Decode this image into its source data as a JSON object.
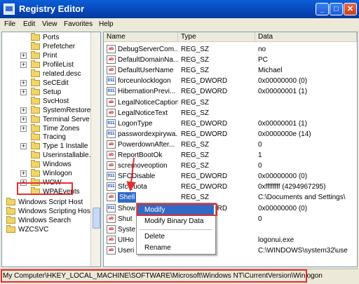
{
  "window": {
    "title": "Registry Editor",
    "min_label": "_",
    "max_label": "□",
    "close_label": "✕"
  },
  "menu": {
    "items": [
      "File",
      "Edit",
      "View",
      "Favorites",
      "Help"
    ]
  },
  "tree": {
    "items": [
      {
        "label": "Ports",
        "expandable": false
      },
      {
        "label": "Prefetcher",
        "expandable": false
      },
      {
        "label": "Print",
        "expandable": true
      },
      {
        "label": "ProfileList",
        "expandable": true
      },
      {
        "label": "related.desc",
        "expandable": false
      },
      {
        "label": "SeCEdit",
        "expandable": true
      },
      {
        "label": "Setup",
        "expandable": true
      },
      {
        "label": "SvcHost",
        "expandable": false
      },
      {
        "label": "SystemRestore",
        "expandable": true
      },
      {
        "label": "Terminal Serve",
        "expandable": true
      },
      {
        "label": "Time Zones",
        "expandable": true
      },
      {
        "label": "Tracing",
        "expandable": false
      },
      {
        "label": "Type 1 Installe",
        "expandable": true
      },
      {
        "label": "Userinstallable.",
        "expandable": false
      },
      {
        "label": "Windows",
        "expandable": false
      },
      {
        "label": "Winlogon",
        "expandable": true,
        "selected": true
      },
      {
        "label": "WOW",
        "expandable": true
      },
      {
        "label": "WPAEvents",
        "expandable": false
      }
    ],
    "parent_items": [
      "Windows Script Host",
      "Windows Scripting Host",
      "Windows Search",
      "WZCSVC"
    ],
    "plus_symbol": "+"
  },
  "list": {
    "headers": {
      "name": "Name",
      "type": "Type",
      "data": "Data"
    },
    "rows": [
      {
        "icon": "ab",
        "name": "DebugServerCom...",
        "type": "REG_SZ",
        "data": "no"
      },
      {
        "icon": "ab",
        "name": "DefaultDomainNa...",
        "type": "REG_SZ",
        "data": "PC"
      },
      {
        "icon": "ab",
        "name": "DefaultUserName",
        "type": "REG_SZ",
        "data": "Michael"
      },
      {
        "icon": "bin",
        "name": "forceunlocklogon",
        "type": "REG_DWORD",
        "data": "0x00000000 (0)"
      },
      {
        "icon": "bin",
        "name": "HibernationPrevi...",
        "type": "REG_DWORD",
        "data": "0x00000001 (1)"
      },
      {
        "icon": "ab",
        "name": "LegalNoticeCaption",
        "type": "REG_SZ",
        "data": ""
      },
      {
        "icon": "ab",
        "name": "LegalNoticeText",
        "type": "REG_SZ",
        "data": ""
      },
      {
        "icon": "bin",
        "name": "LogonType",
        "type": "REG_DWORD",
        "data": "0x00000001 (1)"
      },
      {
        "icon": "bin",
        "name": "passwordexpirywa...",
        "type": "REG_DWORD",
        "data": "0x0000000e (14)"
      },
      {
        "icon": "ab",
        "name": "PowerdownAfter...",
        "type": "REG_SZ",
        "data": "0"
      },
      {
        "icon": "ab",
        "name": "ReportBootOk",
        "type": "REG_SZ",
        "data": "1"
      },
      {
        "icon": "ab",
        "name": "scremoveoption",
        "type": "REG_SZ",
        "data": "0"
      },
      {
        "icon": "bin",
        "name": "SFCDisable",
        "type": "REG_DWORD",
        "data": "0x00000000 (0)"
      },
      {
        "icon": "bin",
        "name": "SfcQuota",
        "type": "REG_DWORD",
        "data": "0xffffffff (4294967295)"
      },
      {
        "icon": "ab",
        "name": "Shell",
        "type": "REG_SZ",
        "data": "C:\\Documents and Settings\\",
        "selected": true
      },
      {
        "icon": "bin",
        "name": "Show",
        "type": "REG_DWORD",
        "data": "0x00000000 (0)"
      },
      {
        "icon": "ab",
        "name": "Shut",
        "type": "REG_SZ",
        "data": "0"
      },
      {
        "icon": "ab",
        "name": "Syste",
        "type": "",
        "data": ""
      },
      {
        "icon": "ab",
        "name": "UIHo",
        "type": "ND_SZ",
        "data": "logonui.exe"
      },
      {
        "icon": "ab",
        "name": "Useri",
        "type": "",
        "data": "C:\\WINDOWS\\system32\\use"
      }
    ],
    "icon_text": {
      "ab": "ab",
      "bin": "011"
    }
  },
  "context_menu": {
    "modify": "Modify",
    "modify_binary": "Modify Binary Data",
    "delete": "Delete",
    "rename": "Rename"
  },
  "status": {
    "path": "My Computer\\HKEY_LOCAL_MACHINE\\SOFTWARE\\Microsoft\\Windows NT\\CurrentVersion\\Winlogon"
  },
  "colors": {
    "highlight": "#316ac5",
    "annotation": "#e03030"
  }
}
